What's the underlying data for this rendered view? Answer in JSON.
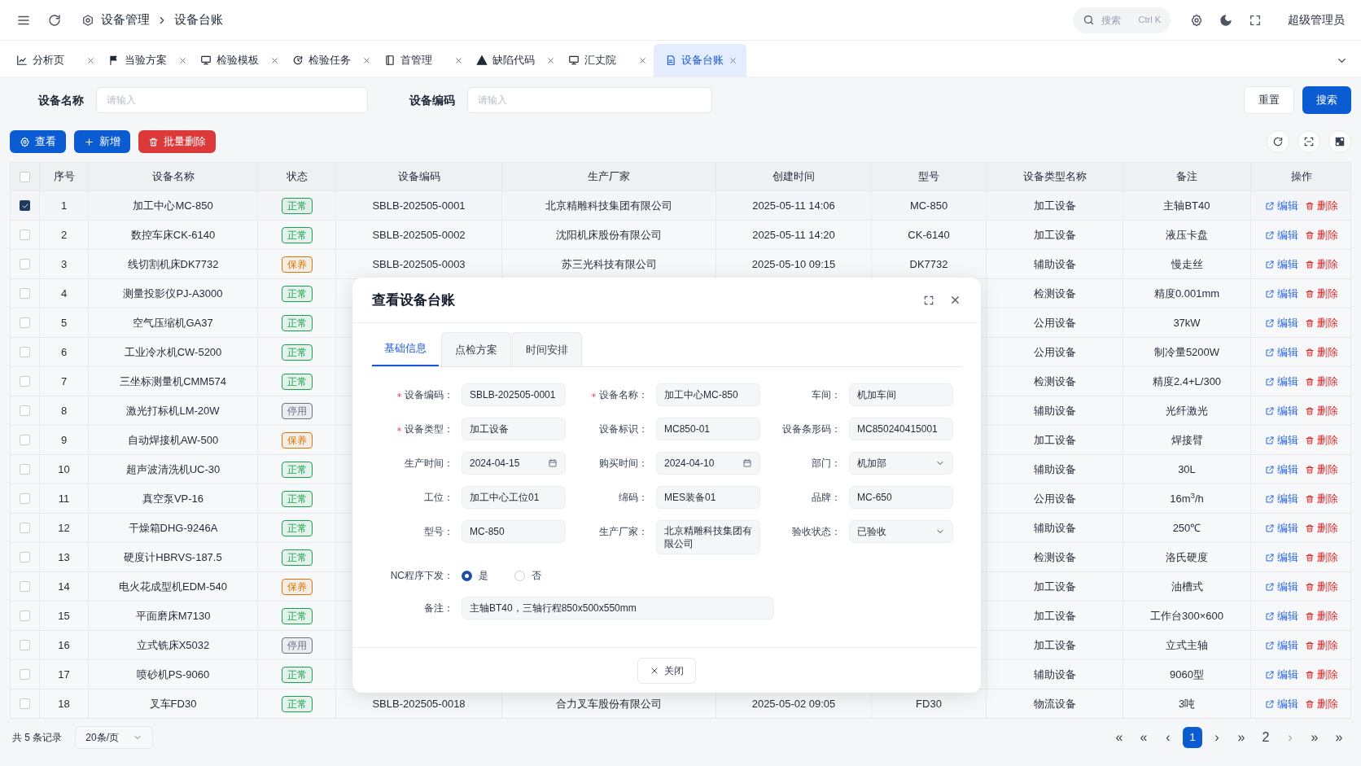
{
  "header": {
    "breadcrumb": [
      "设备管理",
      "设备台账"
    ],
    "search": {
      "placeholder": "搜索",
      "shortcut": "Ctrl K"
    },
    "user": "超级管理员"
  },
  "tabs": [
    {
      "label": "分析页",
      "selected": false
    },
    {
      "label": "当验方案",
      "selected": false
    },
    {
      "label": "检验模板",
      "selected": false
    },
    {
      "label": "检验任务",
      "selected": false
    },
    {
      "label": "首管理",
      "selected": false
    },
    {
      "label": "缺陷代码",
      "selected": false
    },
    {
      "label": "汇丈院",
      "selected": false
    },
    {
      "label": "设备台账",
      "selected": true
    }
  ],
  "filters": [
    {
      "label": "设备名称",
      "placeholder": "请输入"
    },
    {
      "label": "设备编码",
      "placeholder": "请输入"
    }
  ],
  "filter_buttons": [
    {
      "label": "重置",
      "kind": "default"
    },
    {
      "label": "搜索",
      "kind": "primary"
    }
  ],
  "toolbar": [
    {
      "label": "查看",
      "kind": "view"
    },
    {
      "label": "新增",
      "kind": "add"
    },
    {
      "label": "批量删除",
      "kind": "delete"
    }
  ],
  "table": {
    "select_all": {
      "checked": false
    },
    "columns": [
      "序号",
      "设备名称",
      "状态",
      "设备编码",
      "生产厂家",
      "创建时间",
      "型号",
      "设备类型名称",
      "备注",
      "操作"
    ],
    "rows": [
      {
        "checked": true,
        "no": "1",
        "name": "加工中心MC-850",
        "status": {
          "text": "正常",
          "color": "#16a34a"
        },
        "code": "SBLB-202505-0001",
        "maker": "北京精雕科技集团有限公司",
        "created": "2025-05-11 14:06",
        "model": "MC-850",
        "type": "加工设备",
        "note": "主轴BT40",
        "edit": "编辑",
        "delete": "删除"
      },
      {
        "checked": false,
        "no": "2",
        "name": "数控车床CK-6140",
        "status": {
          "text": "正常",
          "color": "#16a34a"
        },
        "code": "SBLB-202505-0002",
        "maker": "沈阳机床股份有限公司",
        "created": "2025-05-11 14:20",
        "model": "CK-6140",
        "type": "加工设备",
        "note": "液压卡盘",
        "edit": "编辑",
        "delete": "删除"
      },
      {
        "checked": false,
        "no": "3",
        "name": "线切割机床DK7732",
        "status": {
          "text": "保养",
          "color": "#d97706"
        },
        "code": "SBLB-202505-0003",
        "maker": "苏三光科技有限公司",
        "created": "2025-05-10 09:15",
        "model": "DK7732",
        "type": "辅助设备",
        "note": "慢走丝",
        "edit": "编辑",
        "delete": "删除"
      },
      {
        "checked": false,
        "no": "4",
        "name": "测量投影仪PJ-A3000",
        "status": {
          "text": "正常",
          "color": "#16a34a"
        },
        "type": "检测设备",
        "note": "精度0.001mm",
        "edit": "编辑",
        "delete": "删除"
      },
      {
        "checked": false,
        "no": "5",
        "name": "空气压缩机GA37",
        "status": {
          "text": "正常",
          "color": "#16a34a"
        },
        "type": "公用设备",
        "note": "37kW",
        "edit": "编辑",
        "delete": "删除"
      },
      {
        "checked": false,
        "no": "6",
        "name": "工业冷水机CW-5200",
        "status": {
          "text": "正常",
          "color": "#16a34a"
        },
        "type": "公用设备",
        "note": "制冷量5200W",
        "edit": "编辑",
        "delete": "删除"
      },
      {
        "checked": false,
        "no": "7",
        "name": "三坐标测量机CMM574",
        "status": {
          "text": "正常",
          "color": "#16a34a"
        },
        "type": "检测设备",
        "note": "精度2.4+L/300",
        "edit": "编辑",
        "delete": "删除"
      },
      {
        "checked": false,
        "no": "8",
        "name": "激光打标机LM-20W",
        "status": {
          "text": "停用",
          "color": "#6b7280"
        },
        "type": "辅助设备",
        "note": "光纤激光",
        "edit": "编辑",
        "delete": "删除"
      },
      {
        "checked": false,
        "no": "9",
        "name": "自动焊接机AW-500",
        "status": {
          "text": "保养",
          "color": "#d97706"
        },
        "type": "加工设备",
        "note": "焊接臂",
        "edit": "编辑",
        "delete": "删除"
      },
      {
        "checked": false,
        "no": "10",
        "name": "超声波清洗机UC-30",
        "status": {
          "text": "正常",
          "color": "#16a34a"
        },
        "type": "辅助设备",
        "note": "30L",
        "edit": "编辑",
        "delete": "删除"
      },
      {
        "checked": false,
        "no": "11",
        "name": "真空泵VP-16",
        "status": {
          "text": "正常",
          "color": "#16a34a"
        },
        "type": "公用设备",
        "note": "16m$^{3}$/h",
        "edit": "编辑",
        "delete": "删除"
      },
      {
        "checked": false,
        "no": "12",
        "name": "干燥箱DHG-9246A",
        "status": {
          "text": "正常",
          "color": "#16a34a"
        },
        "type": "辅助设备",
        "note": "250℃",
        "edit": "编辑",
        "delete": "删除"
      },
      {
        "checked": false,
        "no": "13",
        "name": "硬度计HBRVS-187.5",
        "status": {
          "text": "正常",
          "color": "#16a34a"
        },
        "type": "检测设备",
        "note": "洛氏硬度",
        "edit": "编辑",
        "delete": "删除"
      },
      {
        "checked": false,
        "no": "14",
        "name": "电火花成型机EDM-540",
        "status": {
          "text": "保养",
          "color": "#d97706"
        },
        "type": "加工设备",
        "note": "油槽式",
        "edit": "编辑",
        "delete": "删除"
      },
      {
        "checked": false,
        "no": "15",
        "name": "平面磨床M7130",
        "status": {
          "text": "正常",
          "color": "#16a34a"
        },
        "type": "加工设备",
        "note": "工作台300×600",
        "edit": "编辑",
        "delete": "删除"
      },
      {
        "checked": false,
        "no": "16",
        "name": "立式铣床X5032",
        "status": {
          "text": "停用",
          "color": "#6b7280"
        },
        "type": "加工设备",
        "note": "立式主轴",
        "edit": "编辑",
        "delete": "删除"
      },
      {
        "checked": false,
        "no": "17",
        "name": "喷砂机PS-9060",
        "status": {
          "text": "正常",
          "color": "#16a34a"
        },
        "type": "辅助设备",
        "note": "9060型",
        "edit": "编辑",
        "delete": "删除"
      },
      {
        "checked": false,
        "no": "18",
        "name": "叉车FD30",
        "status": {
          "text": "正常",
          "color": "#16a34a"
        },
        "code": "SBLB-202505-0018",
        "maker": "合力叉车股份有限公司",
        "created": "2025-05-02 09:05",
        "model": "FD30",
        "type": "物流设备",
        "note": "3吨",
        "edit": "编辑",
        "delete": "删除"
      }
    ]
  },
  "footer": {
    "total": "共 5 条记录",
    "page_size": "20条/页",
    "pages": [
      {
        "text": "«",
        "selected": false,
        "disabled": false
      },
      {
        "text": "«",
        "selected": false,
        "disabled": false
      },
      {
        "text": "‹",
        "selected": false,
        "disabled": false
      },
      {
        "text": "1",
        "selected": true,
        "disabled": false
      },
      {
        "text": "›",
        "selected": false,
        "disabled": false
      },
      {
        "text": "»",
        "selected": false,
        "disabled": false
      },
      {
        "text": "2",
        "selected": false,
        "disabled": false
      },
      {
        "text": "›",
        "selected": false,
        "disabled": true
      },
      {
        "text": "»",
        "selected": false,
        "disabled": false
      },
      {
        "text": "»",
        "selected": false,
        "disabled": false
      }
    ]
  },
  "dialog": {
    "title": "查看设备台账",
    "tabs": [
      {
        "label": "基础信息",
        "selected": true
      },
      {
        "label": "点检方案",
        "selected": false
      },
      {
        "label": "时间安排",
        "selected": false
      }
    ],
    "fields": [
      {
        "label": "设备编码：",
        "value": "SBLB-202505-0001",
        "required": true,
        "kind": "text"
      },
      {
        "label": "设备名称：",
        "value": "加工中心MC-850",
        "required": true,
        "kind": "text"
      },
      {
        "label": "车间：",
        "value": "机加车间",
        "required": false,
        "kind": "text"
      },
      {
        "label": "设备类型：",
        "value": "加工设备",
        "required": true,
        "kind": "text"
      },
      {
        "label": "设备标识：",
        "value": "MC850-01",
        "required": false,
        "kind": "text"
      },
      {
        "label": "设备条形码：",
        "value": "MC850240415001",
        "required": false,
        "kind": "text"
      },
      {
        "label": "生产时间：",
        "value": "2024-04-15",
        "required": false,
        "kind": "date"
      },
      {
        "label": "购买时间：",
        "value": "2024-04-10",
        "required": false,
        "kind": "date"
      },
      {
        "label": "部门：",
        "value": "机加部",
        "required": false,
        "kind": "select"
      },
      {
        "label": "工位：",
        "value": "加工中心工位01",
        "required": false,
        "kind": "text"
      },
      {
        "label": "绵码：",
        "value": "MES装备01",
        "required": false,
        "kind": "text"
      },
      {
        "label": "品牌：",
        "value": "MC-650",
        "required": false,
        "kind": "text"
      },
      {
        "label": "型号：",
        "value": "MC-850",
        "required": false,
        "kind": "text"
      },
      {
        "label": "生产厂家：",
        "value": "北京精雕科技集团有限公司",
        "required": false,
        "kind": "textarea"
      },
      {
        "label": "验收状态：",
        "value": "已验收",
        "required": false,
        "kind": "select"
      }
    ],
    "radio": {
      "label": "NC程序下发：",
      "options": [
        {
          "label": "是",
          "selected": true
        },
        {
          "label": "否",
          "selected": false
        }
      ]
    },
    "remark": {
      "label": "备注：",
      "value": "主轴BT40，三轴行程850x500x550mm"
    },
    "close_button": "关闭"
  }
}
